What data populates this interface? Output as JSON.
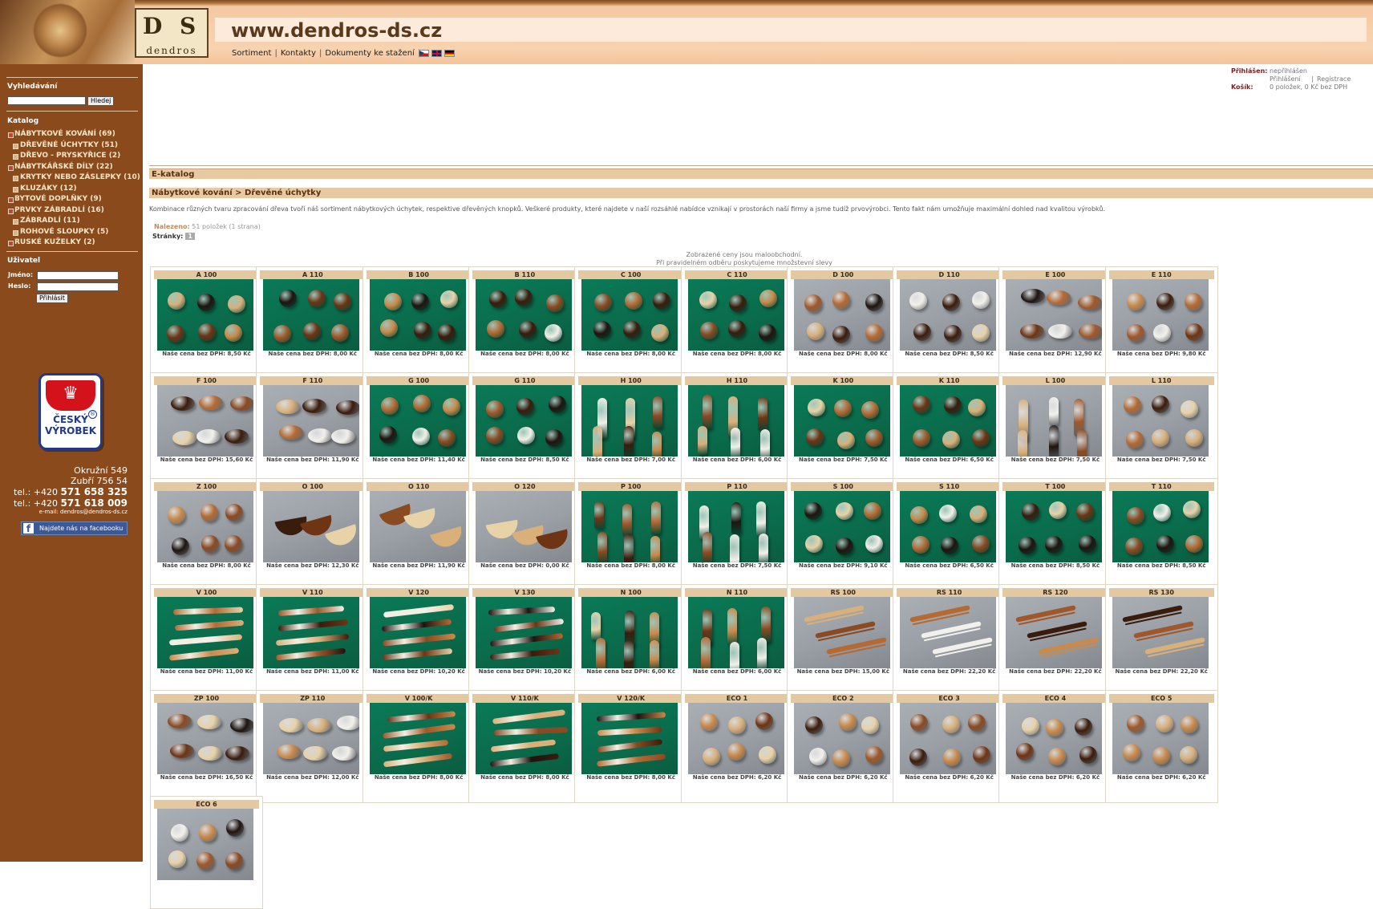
{
  "header": {
    "logo_letters": "D S",
    "logo_name": "dendros",
    "url": "www.dendros-ds.cz",
    "nav": [
      "Sortiment",
      "Kontakty",
      "Dokumenty ke stažení"
    ],
    "flags": [
      "cz-flag-icon",
      "uk-flag-icon",
      "de-flag-icon"
    ]
  },
  "sidebar": {
    "search_title": "Vyhledávání",
    "search_button": "Hledej",
    "catalog_title": "Katalog",
    "catalog": [
      {
        "label": "NÁBYTKOVÉ KOVÁNÍ (69)",
        "level": 0
      },
      {
        "label": "DŘEVĚNÉ ÚCHYTKY (51)",
        "level": 1
      },
      {
        "label": "DŘEVO - PRYSKYŘICE (2)",
        "level": 1
      },
      {
        "label": "NÁBYTKÁŘSKÉ DÍLY (22)",
        "level": 0
      },
      {
        "label": "KRYTKY NEBO ZÁSLEPKY (10)",
        "level": 1
      },
      {
        "label": "KLUZÁKY (12)",
        "level": 1
      },
      {
        "label": "BYTOVÉ DOPLŇKY (9)",
        "level": 0
      },
      {
        "label": "PRVKY ZÁBRADLÍ (16)",
        "level": 0
      },
      {
        "label": "ZÁBRADLÍ (11)",
        "level": 1
      },
      {
        "label": "ROHOVÉ SLOUPKY (5)",
        "level": 1
      },
      {
        "label": "RUSKÉ KUŽELKY (2)",
        "level": 0
      }
    ],
    "user_title": "Uživatel",
    "name_label": "Jméno:",
    "pass_label": "Heslo:",
    "login_button": "Přihlásit",
    "badge_line1": "ČESKÝ",
    "badge_line2": "VÝROBEK",
    "badge_reg": "®",
    "address1": "Okružní 549",
    "address2": "Zubří 756 54",
    "tel1_prefix": "tel.: +420 ",
    "tel1": "571 658 325",
    "tel2_prefix": "tel.: +420 ",
    "tel2": "571 618 009",
    "email": "e-mail: dendros@dendros-ds.cz",
    "facebook_text": "Najdete nás na facebooku",
    "facebook_letter": "f"
  },
  "account": {
    "logged_label": "Přihlášen:",
    "logged_value": "nepřihlášen",
    "login_link": "Přihlášení",
    "register_link": "Registrace",
    "separator": "|",
    "cart_label": "Košík:",
    "cart_value": "0 položek, 0 Kč bez DPH"
  },
  "main": {
    "section": "E-katalog",
    "breadcrumb": "Nábytkové kování > Dřevěné úchytky",
    "description": "Kombinace různých tvaru zpracování dřeva tvoří náš sortiment nábytkových úchytek, respektive dřevěných knopků. Veškeré produkty, které najdete v naší rozsáhlé nabídce vznikají v prostorách naší firmy a jsme tudíž prvovýrobci. Tento fakt nám umožňuje maximální dohled nad kvalitou výrobků.",
    "found_label": "Nalezeno:",
    "found_value": "51 položek (1 strana)",
    "pages_label": "Stránky:",
    "page_num": "1",
    "prices_note1": "Zobrazené ceny jsou maloobchodní.",
    "prices_note2": "Při pravidelném odběru poskytujeme množstevní slevy"
  },
  "products": [
    {
      "code": "A 100",
      "price": "Naše cena bez DPH: 8,50 Kč",
      "bg": "green",
      "kind": "knob"
    },
    {
      "code": "A 110",
      "price": "Naše cena bez DPH: 8,00 Kč",
      "bg": "green",
      "kind": "knob"
    },
    {
      "code": "B 100",
      "price": "Naše cena bez DPH: 8,00 Kč",
      "bg": "green",
      "kind": "knob"
    },
    {
      "code": "B 110",
      "price": "Naše cena bez DPH: 8,00 Kč",
      "bg": "green",
      "kind": "knob"
    },
    {
      "code": "C 100",
      "price": "Naše cena bez DPH: 8,00 Kč",
      "bg": "green",
      "kind": "knob"
    },
    {
      "code": "C 110",
      "price": "Naše cena bez DPH: 8,00 Kč",
      "bg": "green",
      "kind": "knob"
    },
    {
      "code": "D 100",
      "price": "Naše cena bez DPH: 8,00 Kč",
      "bg": "grey",
      "kind": "knob"
    },
    {
      "code": "D 110",
      "price": "Naše cena bez DPH: 8,50 Kč",
      "bg": "grey",
      "kind": "knob"
    },
    {
      "code": "E 100",
      "price": "Naše cena bez DPH: 12,90 Kč",
      "bg": "grey",
      "kind": "dish"
    },
    {
      "code": "E 110",
      "price": "Naše cena bez DPH: 9,80 Kč",
      "bg": "grey",
      "kind": "knob"
    },
    {
      "code": "F 100",
      "price": "Naše cena bez DPH: 15,60 Kč",
      "bg": "grey",
      "kind": "dish"
    },
    {
      "code": "F 110",
      "price": "Naše cena bez DPH: 11,90 Kč",
      "bg": "grey",
      "kind": "dish"
    },
    {
      "code": "G 100",
      "price": "Naše cena bez DPH: 11,40 Kč",
      "bg": "green",
      "kind": "knob"
    },
    {
      "code": "G 110",
      "price": "Naše cena bez DPH: 8,50 Kč",
      "bg": "green",
      "kind": "knob"
    },
    {
      "code": "H 100",
      "price": "Naše cena bez DPH: 7,00 Kč",
      "bg": "green",
      "kind": "tall"
    },
    {
      "code": "H 110",
      "price": "Naše cena bez DPH: 6,00 Kč",
      "bg": "green",
      "kind": "tall"
    },
    {
      "code": "K 100",
      "price": "Naše cena bez DPH: 7,50 Kč",
      "bg": "green",
      "kind": "ball"
    },
    {
      "code": "K 110",
      "price": "Naše cena bez DPH: 6,50 Kč",
      "bg": "green",
      "kind": "ball"
    },
    {
      "code": "L 100",
      "price": "Naše cena bez DPH: 7,50 Kč",
      "bg": "grey",
      "kind": "tall"
    },
    {
      "code": "L 110",
      "price": "Naše cena bez DPH: 7,50 Kč",
      "bg": "grey",
      "kind": "knob"
    },
    {
      "code": "Z 100",
      "price": "Naše cena bez DPH: 8,00 Kč",
      "bg": "grey",
      "kind": "knob"
    },
    {
      "code": "O 100",
      "price": "Naše cena bez DPH: 12,30 Kč",
      "bg": "grey",
      "kind": "shell"
    },
    {
      "code": "O 110",
      "price": "Naše cena bez DPH: 11,90 Kč",
      "bg": "grey",
      "kind": "shell"
    },
    {
      "code": "O 120",
      "price": "Naše cena bez DPH: 0,00 Kč",
      "bg": "grey",
      "kind": "shell"
    },
    {
      "code": "P 100",
      "price": "Naše cena bez DPH: 8,00 Kč",
      "bg": "green",
      "kind": "tall"
    },
    {
      "code": "P 110",
      "price": "Naše cena bez DPH: 7,50 Kč",
      "bg": "green",
      "kind": "tall"
    },
    {
      "code": "S 100",
      "price": "Naše cena bez DPH: 9,10 Kč",
      "bg": "green",
      "kind": "knob"
    },
    {
      "code": "S 110",
      "price": "Naše cena bez DPH: 6,50 Kč",
      "bg": "green",
      "kind": "knob"
    },
    {
      "code": "T 100",
      "price": "Naše cena bez DPH: 8,50 Kč",
      "bg": "green",
      "kind": "knob"
    },
    {
      "code": "T 110",
      "price": "Naše cena bez DPH: 8,50 Kč",
      "bg": "green",
      "kind": "ball"
    },
    {
      "code": "V 100",
      "price": "Naše cena bez DPH: 11,00 Kč",
      "bg": "green",
      "kind": "bar"
    },
    {
      "code": "V 110",
      "price": "Naše cena bez DPH: 11,00 Kč",
      "bg": "green",
      "kind": "bar"
    },
    {
      "code": "V 120",
      "price": "Naše cena bez DPH: 10,20 Kč",
      "bg": "green",
      "kind": "bar"
    },
    {
      "code": "V 130",
      "price": "Naše cena bez DPH: 10,20 Kč",
      "bg": "green",
      "kind": "bar"
    },
    {
      "code": "N 100",
      "price": "Naše cena bez DPH: 6,00 Kč",
      "bg": "green",
      "kind": "tall"
    },
    {
      "code": "N 110",
      "price": "Naše cena bez DPH: 6,00 Kč",
      "bg": "green",
      "kind": "tall"
    },
    {
      "code": "RS 100",
      "price": "Naše cena bez DPH: 15,00 Kč",
      "bg": "grey",
      "kind": "rail"
    },
    {
      "code": "RS 110",
      "price": "Naše cena bez DPH: 22,20 Kč",
      "bg": "grey",
      "kind": "rail"
    },
    {
      "code": "RS 120",
      "price": "Naše cena bez DPH: 22,20 Kč",
      "bg": "grey",
      "kind": "rail"
    },
    {
      "code": "RS 130",
      "price": "Naše cena bez DPH: 22,20 Kč",
      "bg": "grey",
      "kind": "rail"
    },
    {
      "code": "ZP 100",
      "price": "Naše cena bez DPH: 16,50 Kč",
      "bg": "grey",
      "kind": "dish"
    },
    {
      "code": "ZP 110",
      "price": "Naše cena bez DPH: 12,00 Kč",
      "bg": "grey",
      "kind": "dish"
    },
    {
      "code": "V 100/K",
      "price": "Naše cena bez DPH: 8,00 Kč",
      "bg": "green",
      "kind": "bar"
    },
    {
      "code": "V 110/K",
      "price": "Naše cena bez DPH: 8,00 Kč",
      "bg": "green",
      "kind": "bar"
    },
    {
      "code": "V 120/K",
      "price": "Naše cena bez DPH: 8,00 Kč",
      "bg": "green",
      "kind": "bar"
    },
    {
      "code": "ECO 1",
      "price": "Naše cena bez DPH: 6,20 Kč",
      "bg": "grey",
      "kind": "ball"
    },
    {
      "code": "ECO 2",
      "price": "Naše cena bez DPH: 6,20 Kč",
      "bg": "grey",
      "kind": "ball"
    },
    {
      "code": "ECO 3",
      "price": "Naše cena bez DPH: 6,20 Kč",
      "bg": "grey",
      "kind": "knob"
    },
    {
      "code": "ECO 4",
      "price": "Naše cena bez DPH: 6,20 Kč",
      "bg": "grey",
      "kind": "knob"
    },
    {
      "code": "ECO 5",
      "price": "Naše cena bez DPH: 6,20 Kč",
      "bg": "grey",
      "kind": "knob"
    },
    {
      "code": "ECO 6",
      "price": "",
      "bg": "grey",
      "kind": "knob"
    }
  ]
}
